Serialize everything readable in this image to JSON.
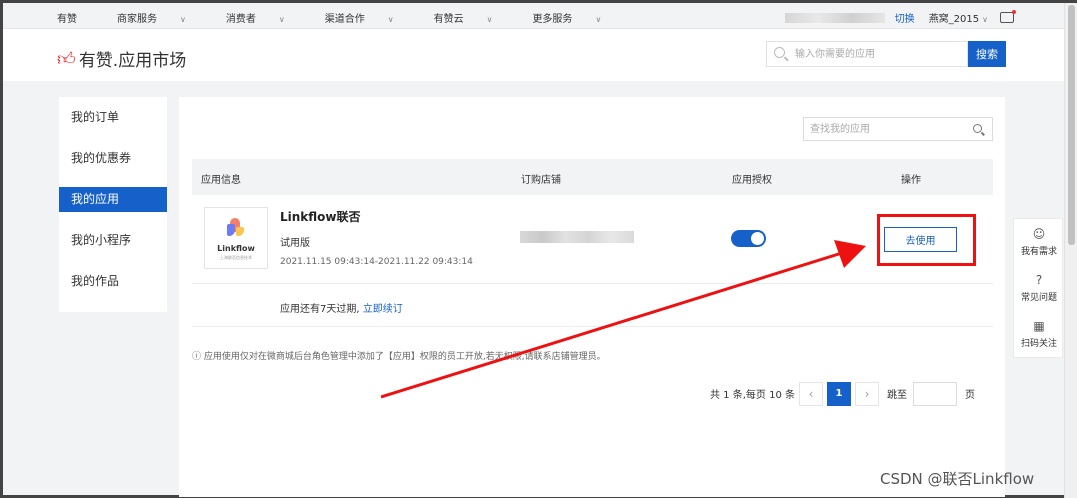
{
  "topbar": {
    "nav": [
      {
        "label": "有赞",
        "caret": false
      },
      {
        "label": "商家服务",
        "caret": true
      },
      {
        "label": "消费者",
        "caret": true
      },
      {
        "label": "渠道合作",
        "caret": true
      },
      {
        "label": "有赞云",
        "caret": true
      },
      {
        "label": "更多服务",
        "caret": true
      }
    ],
    "switch_label": "切换",
    "user_label": "燕窝_2015"
  },
  "header": {
    "logo_text": "有赞.应用市场",
    "search_placeholder": "输入你需要的应用",
    "search_button": "搜索"
  },
  "sidebar": {
    "items": [
      {
        "label": "我的订单"
      },
      {
        "label": "我的优惠券"
      },
      {
        "label": "我的应用",
        "active": true
      },
      {
        "label": "我的小程序"
      },
      {
        "label": "我的作品"
      }
    ]
  },
  "main": {
    "search_placeholder": "查找我的应用",
    "columns": [
      "应用信息",
      "订购店铺",
      "应用授权",
      "操作"
    ],
    "row": {
      "logo_word": "Linkflow",
      "logo_sub": "上海联否信息技术",
      "name": "Linkflow联否",
      "version": "试用版",
      "date_range": "2021.11.15 09:43:14-2021.11.22 09:43:14",
      "authorized": true,
      "action_label": "去使用",
      "expire_text": "应用还有7天过期,",
      "renew_link": "立即续订"
    },
    "note": "ⓘ 应用使用仅对在微商城后台角色管理中添加了【应用】权限的员工开放,若无权限,请联系店铺管理员。",
    "pager": {
      "summary": "共 1 条,每页 10 条",
      "prev": "‹",
      "current": "1",
      "next": "›",
      "jump_label": "跳至",
      "unit": "页"
    }
  },
  "float_panel": {
    "items": [
      {
        "label": "我有需求",
        "icon": "smile-chat-icon"
      },
      {
        "label": "常见问题",
        "icon": "question-icon"
      },
      {
        "label": "扫码关注",
        "icon": "qrcode-icon"
      }
    ]
  },
  "watermark": "CSDN @联否Linkflow",
  "colors": {
    "accent": "#1660c9",
    "highlight": "#e11111",
    "brand_red": "#e02424"
  }
}
